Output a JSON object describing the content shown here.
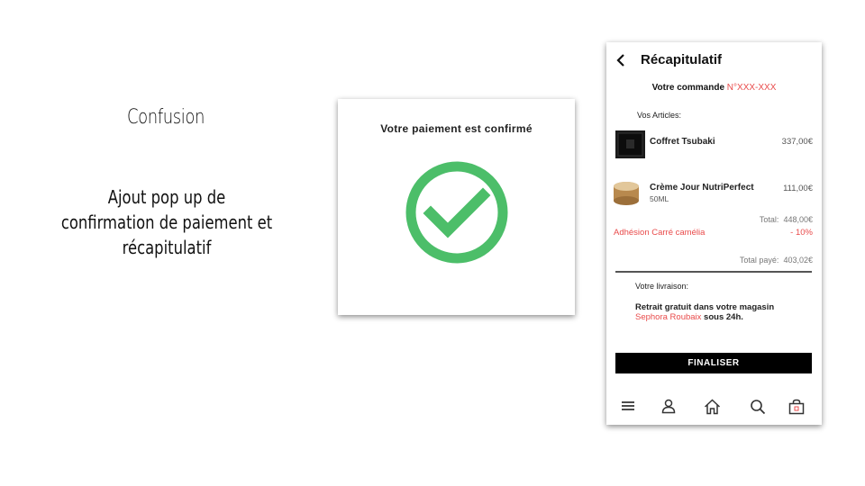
{
  "slide": {
    "title": "Confusion",
    "description": "Ajout pop up de confirmation de paiement et récapitulatif"
  },
  "popup": {
    "title": "Votre paiement est confirmé",
    "icon": "check-circle-icon",
    "accent_color": "#4cbe69"
  },
  "phone": {
    "header": {
      "back_icon": "chevron-left-icon",
      "title": "Récapitulatif"
    },
    "order": {
      "label": "Votre commande",
      "number": "N°XXX-XXX"
    },
    "articles_label": "Vos Articles:",
    "items": [
      {
        "name": "Coffret Tsubaki",
        "subtitle": "",
        "price": "337,00€"
      },
      {
        "name": "Crème Jour NutriPerfect",
        "subtitle": "50ML",
        "price": "111,00€"
      }
    ],
    "total_label": "Total:",
    "total_value": "448,00€",
    "discount_label": "Adhésion Carré camélia",
    "discount_value": "- 10%",
    "paid_label": "Total payé:",
    "paid_value": "403,02€",
    "shipping_label": "Votre livraison:",
    "shipping_text_1": "Retrait gratuit dans votre magasin",
    "shipping_store": "Sephora Roubaix",
    "shipping_text_2": " sous 24h.",
    "finalize_label": "FINALISER",
    "accent_color": "#e94b4b",
    "nav": [
      "menu-icon",
      "user-icon",
      "home-icon",
      "search-icon",
      "bag-icon"
    ]
  }
}
